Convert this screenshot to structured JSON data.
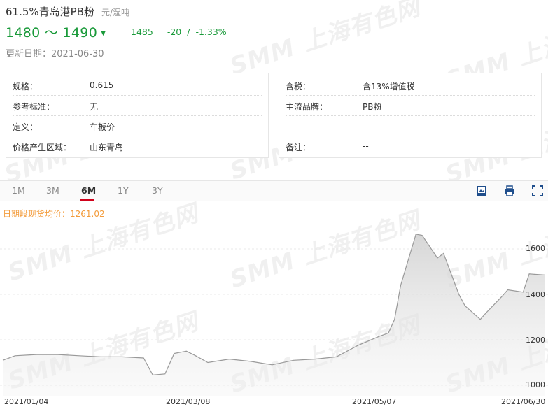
{
  "header": {
    "title": "61.5%青岛港PB粉",
    "unit": "元/湿吨",
    "price_range": "1480 ～ 1490",
    "average": "1485",
    "change": "-20",
    "separator": "/",
    "change_pct": "-1.33%",
    "update_date": "更新日期：2021-06-30"
  },
  "specs_left": [
    {
      "key": "规格：",
      "value": "0.615"
    },
    {
      "key": "参考标准：",
      "value": "无"
    },
    {
      "key": "定义：",
      "value": "车板价"
    },
    {
      "key": "价格产生区域：",
      "value": "山东青岛"
    }
  ],
  "specs_right": [
    {
      "key": "含税：",
      "value": "含13%增值税"
    },
    {
      "key": "主流品牌：",
      "value": "PB粉"
    },
    {
      "key": "",
      "value": ""
    },
    {
      "key": "备注：",
      "value": "--"
    }
  ],
  "tabs": [
    "1M",
    "3M",
    "6M",
    "1Y",
    "3Y"
  ],
  "active_tab": "6M",
  "tools": {
    "image": "image-download-icon",
    "print": "print-icon",
    "fullscreen": "fullscreen-icon"
  },
  "legend": "日期段现货均价：1261.02",
  "watermark": "SMM 上海有色网",
  "colors": {
    "down": "#1a9a3a",
    "accent": "#d0021b",
    "legend": "#f39c3c",
    "series": "#888888"
  },
  "chart_data": {
    "type": "area",
    "x_ticks": [
      "2021/01/04",
      "2021/03/08",
      "2021/05/07",
      "2021/06/30"
    ],
    "y_ticks": [
      "1000",
      "1200",
      "1400",
      "1600"
    ],
    "ylim": [
      1000,
      1660
    ],
    "x": [
      "2021/01/04",
      "2021/01/08",
      "2021/01/15",
      "2021/01/22",
      "2021/01/29",
      "2021/02/05",
      "2021/02/12",
      "2021/02/19",
      "2021/02/22",
      "2021/02/26",
      "2021/03/01",
      "2021/03/05",
      "2021/03/08",
      "2021/03/12",
      "2021/03/19",
      "2021/03/26",
      "2021/04/02",
      "2021/04/09",
      "2021/04/16",
      "2021/04/23",
      "2021/04/30",
      "2021/05/07",
      "2021/05/10",
      "2021/05/12",
      "2021/05/14",
      "2021/05/19",
      "2021/05/21",
      "2021/05/26",
      "2021/05/28",
      "2021/06/02",
      "2021/06/04",
      "2021/06/09",
      "2021/06/11",
      "2021/06/16",
      "2021/06/18",
      "2021/06/23",
      "2021/06/25",
      "2021/06/30"
    ],
    "series": [
      {
        "values": [
          1110,
          1130,
          1135,
          1135,
          1130,
          1125,
          1125,
          1120,
          1045,
          1050,
          1140,
          1150,
          1130,
          1100,
          1115,
          1105,
          1090,
          1110,
          1115,
          1125,
          1175,
          1215,
          1230,
          1290,
          1440,
          1665,
          1660,
          1560,
          1580,
          1400,
          1350,
          1290,
          1320,
          1390,
          1420,
          1410,
          1490,
          1485
        ]
      }
    ]
  }
}
